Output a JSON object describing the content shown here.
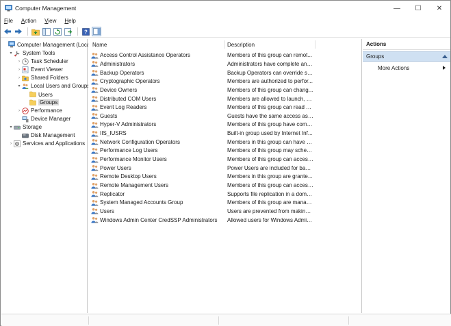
{
  "window": {
    "title": "Computer Management",
    "controls": {
      "minimize": "—",
      "maximize": "☐",
      "close": "✕"
    }
  },
  "menu": {
    "items": [
      {
        "label": "File",
        "accel": "F",
        "rest": "ile"
      },
      {
        "label": "Action",
        "accel": "A",
        "rest": "ction"
      },
      {
        "label": "View",
        "accel": "V",
        "rest": "iew"
      },
      {
        "label": "Help",
        "accel": "H",
        "rest": "elp"
      }
    ]
  },
  "toolbar": {
    "buttons": [
      "back-arrow-icon",
      "forward-arrow-icon",
      "up-folder-icon",
      "show-hide-tree-icon",
      "refresh-icon",
      "export-list-icon",
      "help-icon",
      "action-pane-icon"
    ]
  },
  "tree": {
    "items": [
      {
        "label": "Computer Management (Local)",
        "icon": "computer-management-icon",
        "expander": "",
        "level": 0
      },
      {
        "label": "System Tools",
        "icon": "system-tools-icon",
        "expander": "▾",
        "level": 1
      },
      {
        "label": "Task Scheduler",
        "icon": "task-scheduler-icon",
        "expander": "›",
        "level": 2
      },
      {
        "label": "Event Viewer",
        "icon": "event-viewer-icon",
        "expander": "›",
        "level": 2
      },
      {
        "label": "Shared Folders",
        "icon": "shared-folders-icon",
        "expander": "›",
        "level": 2
      },
      {
        "label": "Local Users and Groups",
        "icon": "local-users-groups-icon",
        "expander": "▾",
        "level": 2
      },
      {
        "label": "Users",
        "icon": "folder-icon",
        "expander": "",
        "level": 3
      },
      {
        "label": "Groups",
        "icon": "folder-icon",
        "expander": "",
        "level": 3,
        "selected": true
      },
      {
        "label": "Performance",
        "icon": "performance-icon",
        "expander": "›",
        "level": 2
      },
      {
        "label": "Device Manager",
        "icon": "device-manager-icon",
        "expander": "",
        "level": 2
      },
      {
        "label": "Storage",
        "icon": "storage-icon",
        "expander": "▾",
        "level": 1
      },
      {
        "label": "Disk Management",
        "icon": "disk-management-icon",
        "expander": "",
        "level": 2
      },
      {
        "label": "Services and Applications",
        "icon": "services-applications-icon",
        "expander": "›",
        "level": 1
      }
    ]
  },
  "list": {
    "columns": {
      "name": "Name",
      "description": "Description"
    },
    "rows": [
      {
        "name": "Access Control Assistance Operators",
        "description": "Members of this group can remot..."
      },
      {
        "name": "Administrators",
        "description": "Administrators have complete and..."
      },
      {
        "name": "Backup Operators",
        "description": "Backup Operators can override sec..."
      },
      {
        "name": "Cryptographic Operators",
        "description": "Members are authorized to perfor..."
      },
      {
        "name": "Device Owners",
        "description": "Members of this group can chang..."
      },
      {
        "name": "Distributed COM Users",
        "description": "Members are allowed to launch, ac..."
      },
      {
        "name": "Event Log Readers",
        "description": "Members of this group can read e..."
      },
      {
        "name": "Guests",
        "description": "Guests have the same access as m..."
      },
      {
        "name": "Hyper-V Administrators",
        "description": "Members of this group have comp..."
      },
      {
        "name": "IIS_IUSRS",
        "description": "Built-in group used by Internet Inf..."
      },
      {
        "name": "Network Configuration Operators",
        "description": "Members in this group can have s..."
      },
      {
        "name": "Performance Log Users",
        "description": "Members of this group may sched..."
      },
      {
        "name": "Performance Monitor Users",
        "description": "Members of this group can access ..."
      },
      {
        "name": "Power Users",
        "description": "Power Users are included for back..."
      },
      {
        "name": "Remote Desktop Users",
        "description": "Members in this group are grante..."
      },
      {
        "name": "Remote Management Users",
        "description": "Members of this group can access ..."
      },
      {
        "name": "Replicator",
        "description": "Supports file replication in a doma..."
      },
      {
        "name": "System Managed Accounts Group",
        "description": "Members of this group are manag..."
      },
      {
        "name": "Users",
        "description": "Users are prevented from making ..."
      },
      {
        "name": "Windows Admin Center CredSSP Administrators",
        "description": "Allowed users for Windows Admin ..."
      }
    ]
  },
  "actions": {
    "title": "Actions",
    "section": "Groups",
    "more_actions": "More Actions"
  },
  "colors": {
    "selection": "#d9d9d9",
    "actions_section_bg": "#cfe0f2",
    "accent_blue": "#2f6fb5"
  }
}
